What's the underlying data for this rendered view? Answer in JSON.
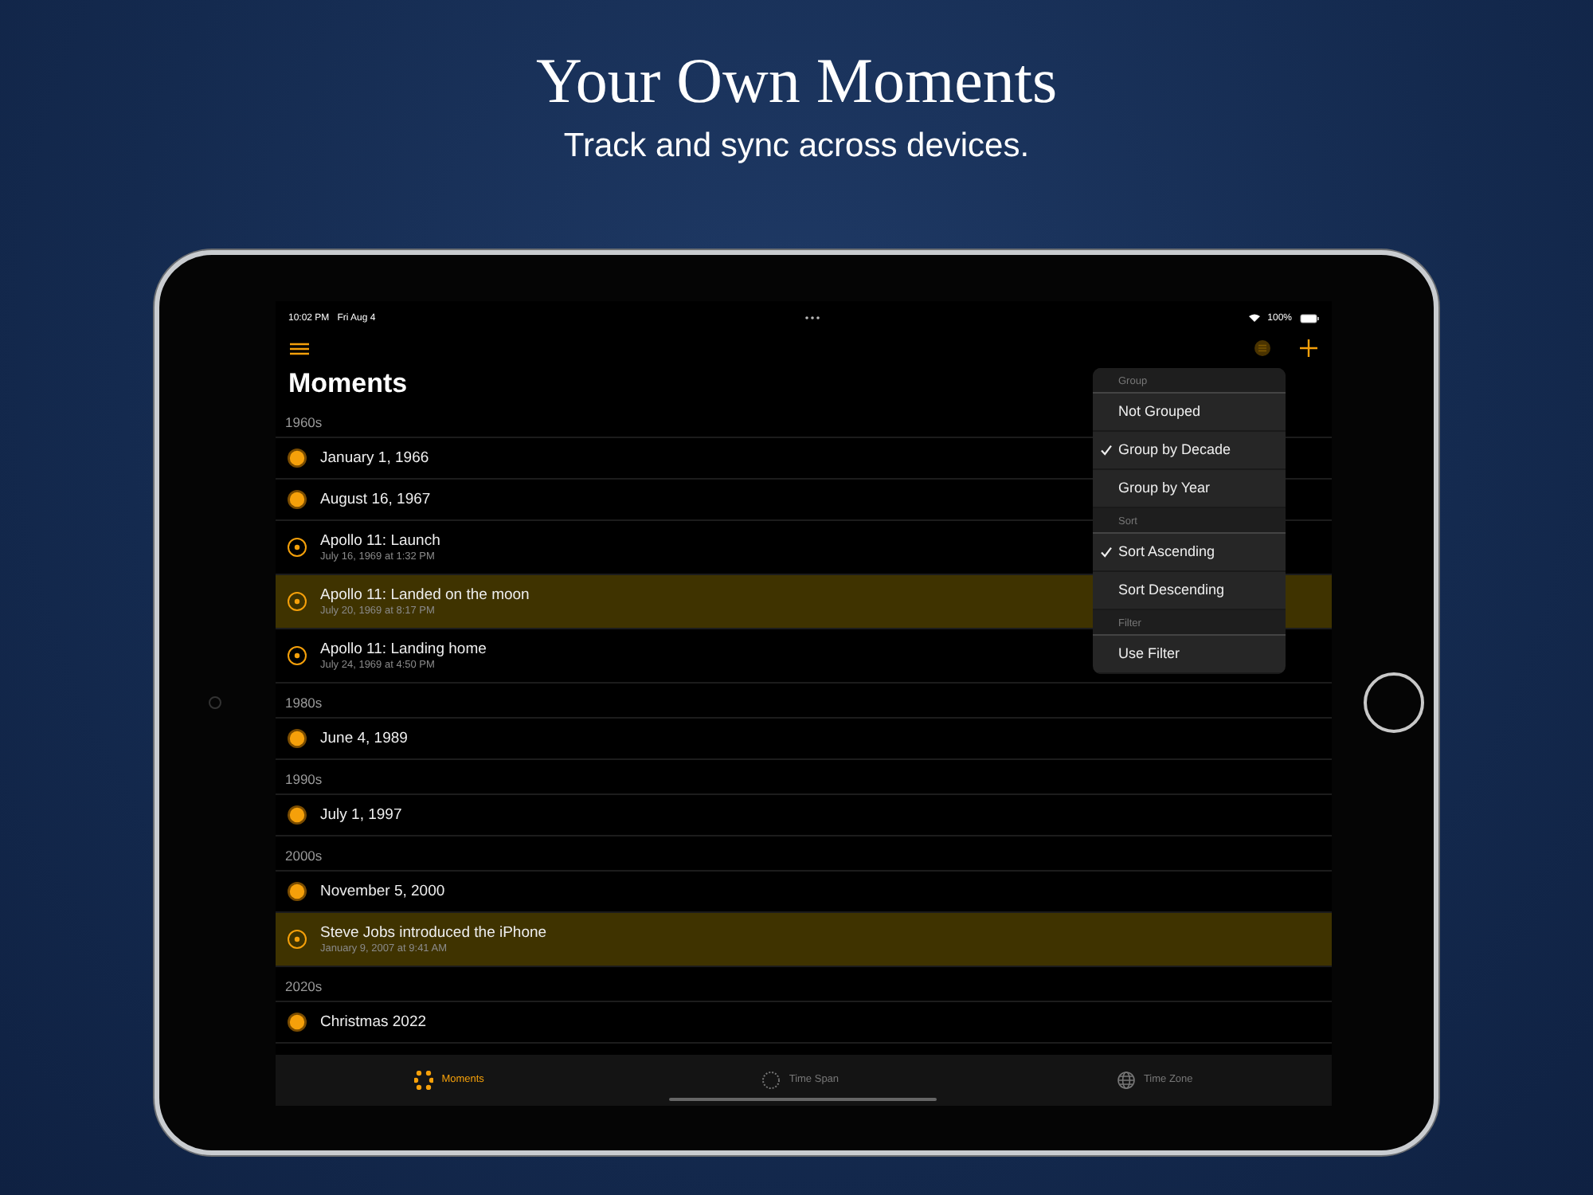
{
  "headline": {
    "title": "Your Own Moments",
    "subtitle": "Track and sync across devices."
  },
  "status_bar": {
    "time": "10:02 PM",
    "date": "Fri Aug 4",
    "battery": "100%"
  },
  "screen_title": "Moments",
  "sections": [
    {
      "header": "1960s",
      "rows": [
        {
          "kind": "date",
          "title": "January 1, 1966",
          "selected": false
        },
        {
          "kind": "date",
          "title": "August 16, 1967",
          "selected": false
        },
        {
          "kind": "event",
          "title": "Apollo 11: Launch",
          "detail": "July 16, 1969 at 1:32 PM",
          "selected": false
        },
        {
          "kind": "event",
          "title": "Apollo 11: Landed on the moon",
          "detail": "July 20, 1969 at 8:17 PM",
          "selected": true
        },
        {
          "kind": "event",
          "title": "Apollo 11: Landing home",
          "detail": "July 24, 1969 at 4:50 PM",
          "selected": false
        }
      ]
    },
    {
      "header": "1980s",
      "rows": [
        {
          "kind": "date",
          "title": "June 4, 1989",
          "selected": false
        }
      ]
    },
    {
      "header": "1990s",
      "rows": [
        {
          "kind": "date",
          "title": "July 1, 1997",
          "selected": false
        }
      ]
    },
    {
      "header": "2000s",
      "rows": [
        {
          "kind": "date",
          "title": "November 5, 2000",
          "selected": false
        },
        {
          "kind": "event",
          "title": "Steve Jobs introduced the iPhone",
          "detail": "January 9, 2007 at 9:41 AM",
          "selected": true
        }
      ]
    },
    {
      "header": "2020s",
      "rows": [
        {
          "kind": "date",
          "title": "Christmas 2022",
          "selected": false
        }
      ]
    }
  ],
  "menu": [
    {
      "header": "Group",
      "items": [
        {
          "label": "Not Grouped",
          "checked": false
        },
        {
          "label": "Group by Decade",
          "checked": true
        },
        {
          "label": "Group by Year",
          "checked": false
        }
      ]
    },
    {
      "header": "Sort",
      "items": [
        {
          "label": "Sort Ascending",
          "checked": true
        },
        {
          "label": "Sort Descending",
          "checked": false
        }
      ]
    },
    {
      "header": "Filter",
      "items": [
        {
          "label": "Use Filter",
          "checked": false
        }
      ]
    }
  ],
  "tabs": [
    {
      "label": "Moments",
      "selected": true
    },
    {
      "label": "Time Span",
      "selected": false
    },
    {
      "label": "Time Zone",
      "selected": false
    }
  ]
}
